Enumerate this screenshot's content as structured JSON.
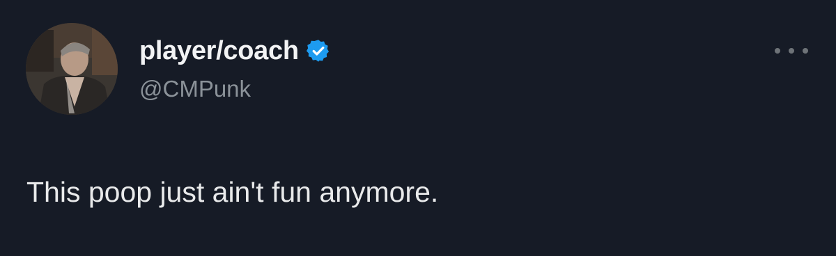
{
  "tweet": {
    "author": {
      "display_name": "player/coach",
      "handle": "@CMPunk",
      "verified": true,
      "verified_icon": "verified-badge-icon",
      "verified_color": "#1d9bf0",
      "avatar": "profile-photo"
    },
    "more_menu_icon": "more-options-icon",
    "text": "This poop just ain't fun anymore."
  },
  "theme": {
    "background": "#161b26",
    "primary_text": "#e7e9ea",
    "secondary_text": "#8b9299"
  }
}
